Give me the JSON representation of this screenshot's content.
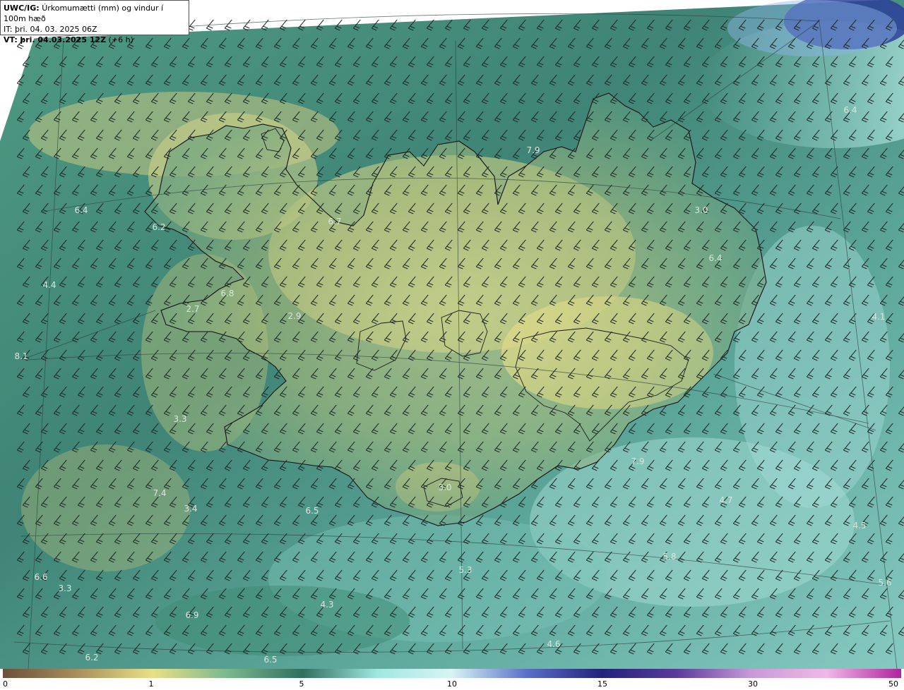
{
  "header": {
    "model": "UWC/IG:",
    "title": "Úrkomumætti (mm) og vindur í 100m hæð",
    "issue_time": "IT: þri. 04. 03. 2025 06Z",
    "valid_label": "VT:",
    "valid_time": "þri. 04.03.2025 12Z",
    "valid_offset": "(+6 h)"
  },
  "map_labels": [
    "6.4",
    "6.2",
    "6.7",
    "4.4",
    "6.8",
    "2.7",
    "2.9",
    "7.9",
    "3.0",
    "6.4",
    "6.4",
    "4.1",
    "8.1",
    "3.3",
    "7.9",
    "3.0",
    "7.4",
    "3.4",
    "6.5",
    "4.7",
    "4.5",
    "6.6",
    "3.3",
    "5.3",
    "5.6",
    "4.3",
    "6.9",
    "4.6",
    "5.8",
    "6.2",
    "6.5"
  ],
  "legend": {
    "ticks": [
      "0",
      "1",
      "5",
      "10",
      "15",
      "30",
      "50"
    ],
    "colors": [
      "#6b4f3a",
      "#a88f5c",
      "#e8e088",
      "#7bb88e",
      "#2f6f5e",
      "#9fe8e0",
      "#d8f4f4",
      "#5a6fc8",
      "#22227a",
      "#5a3b9a",
      "#c89ad8",
      "#f0b8e8",
      "#b0239c"
    ]
  },
  "colors": {
    "sea_field": "#4e9688",
    "land_field": "#dcd98a",
    "coast": "#111111"
  }
}
